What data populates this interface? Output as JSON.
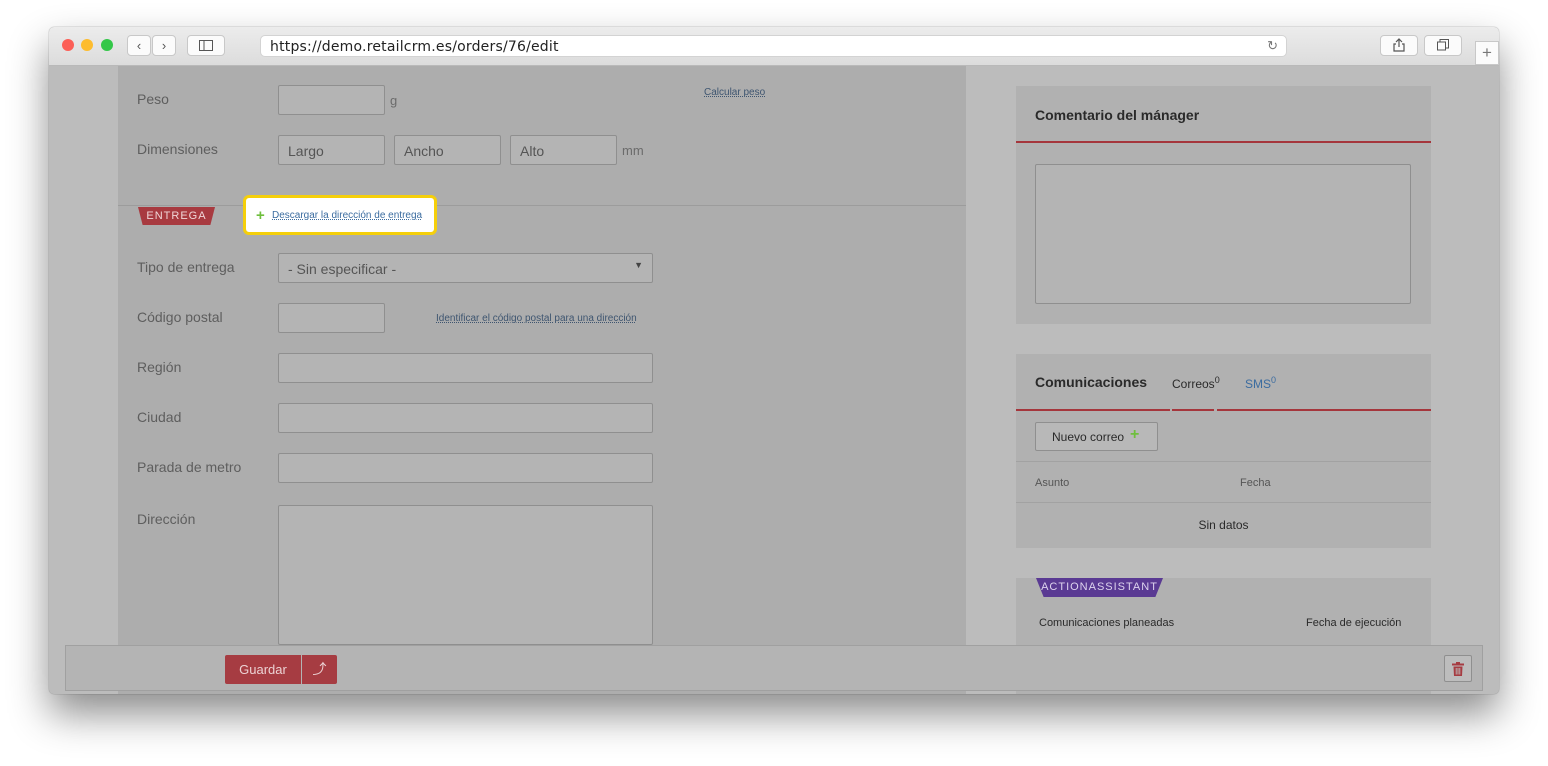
{
  "browser": {
    "url": "https://demo.retailcrm.es/orders/76/edit",
    "traffic_light_colors": [
      "#fc5f57",
      "#fdbc2e",
      "#33c748"
    ]
  },
  "left": {
    "peso_label": "Peso",
    "peso_unit": "g",
    "calcular_link": "Calcular peso",
    "dimensiones_label": "Dimensiones",
    "largo_placeholder": "Largo",
    "ancho_placeholder": "Ancho",
    "alto_placeholder": "Alto",
    "dimensiones_unit": "mm",
    "entrega_tag": "ENTREGA",
    "descargar_link": "Descargar la dirección de entrega",
    "tipo_label": "Tipo de entrega",
    "tipo_value": "- Sin especificar -",
    "codigo_label": "Código postal",
    "identificar_link": "Identificar el código postal para una dirección",
    "region_label": "Región",
    "ciudad_label": "Ciudad",
    "metro_label": "Parada de metro",
    "direccion_label": "Dirección"
  },
  "right": {
    "comentario_title": "Comentario del mánager",
    "comunicaciones_title": "Comunicaciones",
    "correos_tab": "Correos",
    "correos_count": "0",
    "sms_tab": "SMS",
    "sms_count": "0",
    "nuevo_correo": "Nuevo correo",
    "col_asunto": "Asunto",
    "col_fecha": "Fecha",
    "sin_datos": "Sin datos",
    "action_tag": "ACTIONASSISTANT",
    "planeadas_label": "Comunicaciones planeadas",
    "fecha_ejecucion": "Fecha de ejecución"
  },
  "footer": {
    "guardar": "Guardar",
    "upload_icon": "arrow-up-icon",
    "trash_icon": "trash-icon"
  },
  "colors": {
    "accent_red": "#a63c42",
    "highlight_yellow": "#f5cf0a",
    "action_purple": "#5a3a93",
    "link_blue": "#3b6ca0",
    "plus_green": "#6fbf3d"
  }
}
